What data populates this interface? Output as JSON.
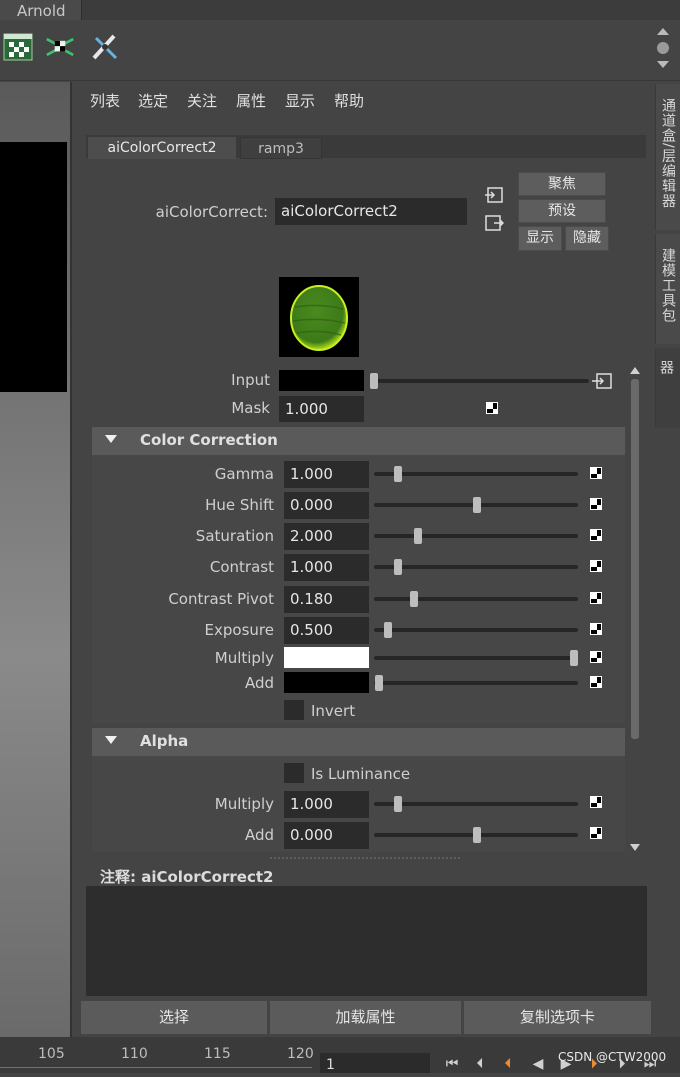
{
  "window": {
    "tab_label": "Arnold"
  },
  "toolbar": {
    "icons": [
      "checker-window-icon",
      "uv-layout-icon",
      "pen-eraser-icon"
    ]
  },
  "side_tabs": [
    "通道盒/层编辑器",
    "建模工具包",
    "属性编辑器"
  ],
  "menu": [
    "列表",
    "选定",
    "关注",
    "属性",
    "显示",
    "帮助"
  ],
  "node_tabs": [
    "aiColorCorrect2",
    "ramp3"
  ],
  "node": {
    "type_label": "aiColorCorrect:",
    "name_value": "aiColorCorrect2",
    "focus_button": "聚焦",
    "presets_button": "预设",
    "show_button": "显示",
    "hide_button": "隐藏"
  },
  "attributes": {
    "input_label": "Input",
    "mask_label": "Mask",
    "mask_value": "1.000"
  },
  "color_correction": {
    "title": "Color Correction",
    "rows": [
      {
        "label": "Gamma",
        "value": "1.000"
      },
      {
        "label": "Hue Shift",
        "value": "0.000"
      },
      {
        "label": "Saturation",
        "value": "2.000"
      },
      {
        "label": "Contrast",
        "value": "1.000"
      },
      {
        "label": "Contrast Pivot",
        "value": "0.180"
      },
      {
        "label": "Exposure",
        "value": "0.500"
      }
    ],
    "multiply_label": "Multiply",
    "multiply_color": "#ffffff",
    "add_label": "Add",
    "add_color": "#000000",
    "invert_label": "Invert"
  },
  "alpha": {
    "title": "Alpha",
    "is_luminance_label": "Is Luminance",
    "multiply_label": "Multiply",
    "multiply_value": "1.000",
    "add_label": "Add",
    "add_value": "0.000"
  },
  "notes": {
    "label": "注释:",
    "node": "aiColorCorrect2"
  },
  "bottom_buttons": [
    "选择",
    "加载属性",
    "复制选项卡"
  ],
  "timeline": {
    "ticks": [
      "105",
      "110",
      "115",
      "120"
    ],
    "frame_value": "1"
  },
  "watermark": "CSDN @CTW2000"
}
